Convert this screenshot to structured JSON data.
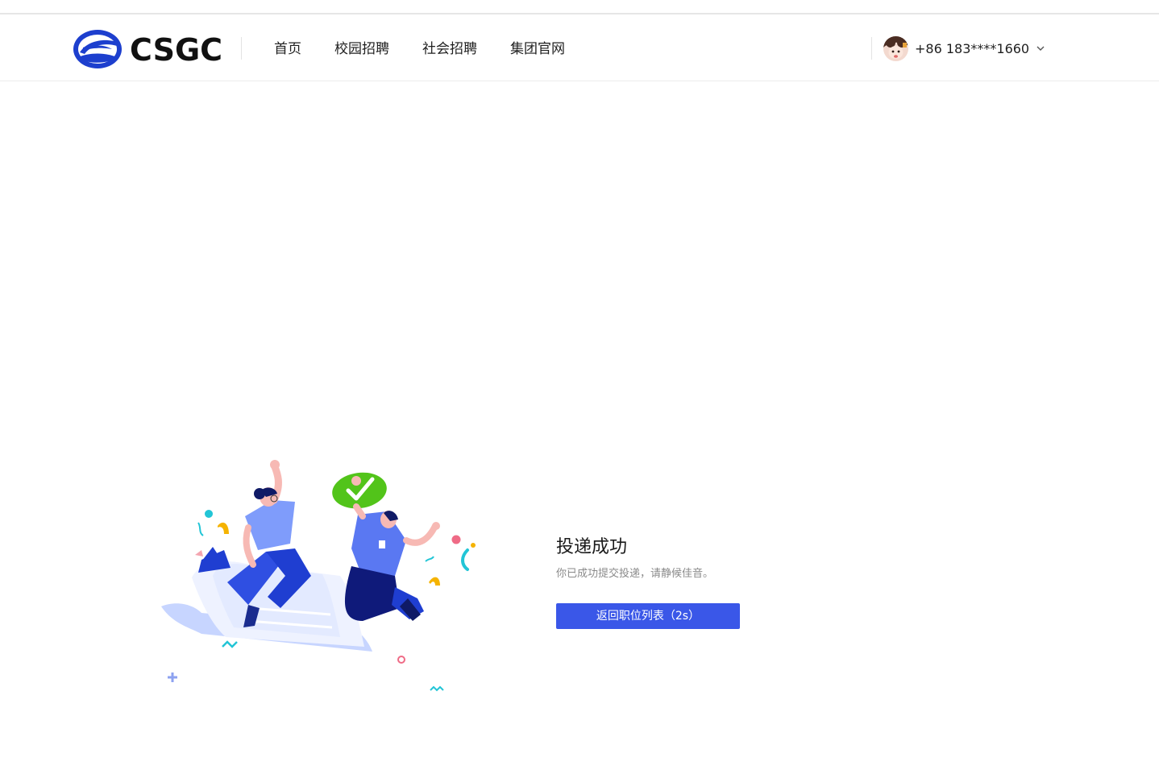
{
  "header": {
    "logo_text": "CSGC",
    "nav": [
      {
        "label": "首页"
      },
      {
        "label": "校园招聘"
      },
      {
        "label": "社会招聘"
      },
      {
        "label": "集团官网"
      }
    ],
    "user": {
      "phone": "+86  183****1660",
      "dropdown_icon": "chevron-down-icon"
    }
  },
  "result": {
    "title": "投递成功",
    "description": "你已成功提交投递，请静候佳音。",
    "button_label": "返回职位列表（2s）"
  },
  "colors": {
    "brand_blue": "#1d3fce",
    "button_blue": "#3a57e8",
    "check_green": "#52c41a"
  }
}
